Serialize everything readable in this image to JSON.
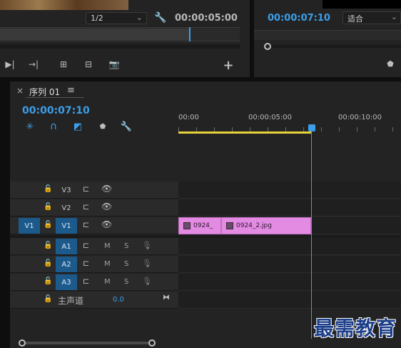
{
  "source_monitor": {
    "zoom_select": "1/2",
    "duration_tc": "00:00:05:00"
  },
  "program_monitor": {
    "current_tc": "00:00:07:10",
    "fit_select": "适合"
  },
  "timeline": {
    "close": "×",
    "sequence_name": "序列 01",
    "menu": "≡",
    "playhead_tc": "00:00:07:10",
    "ruler": [
      "00:00",
      "00:00:05:00",
      "00:00:10:00"
    ],
    "video_tracks": [
      {
        "name": "V3",
        "target": ""
      },
      {
        "name": "V2",
        "target": ""
      },
      {
        "name": "V1",
        "target": "V1"
      }
    ],
    "audio_tracks": [
      {
        "name": "A1",
        "m": "M",
        "s": "S"
      },
      {
        "name": "A2",
        "m": "M",
        "s": "S"
      },
      {
        "name": "A3",
        "m": "M",
        "s": "S"
      }
    ],
    "master": {
      "label": "主声道",
      "value": "0.0"
    },
    "clips": [
      {
        "name": "0924_"
      },
      {
        "name": "0924_2.jpg"
      }
    ]
  },
  "watermark": "最需教育",
  "colors": {
    "accent": "#3c9ee8",
    "clip": "#e38ae3",
    "target": "#1d5a8c"
  }
}
